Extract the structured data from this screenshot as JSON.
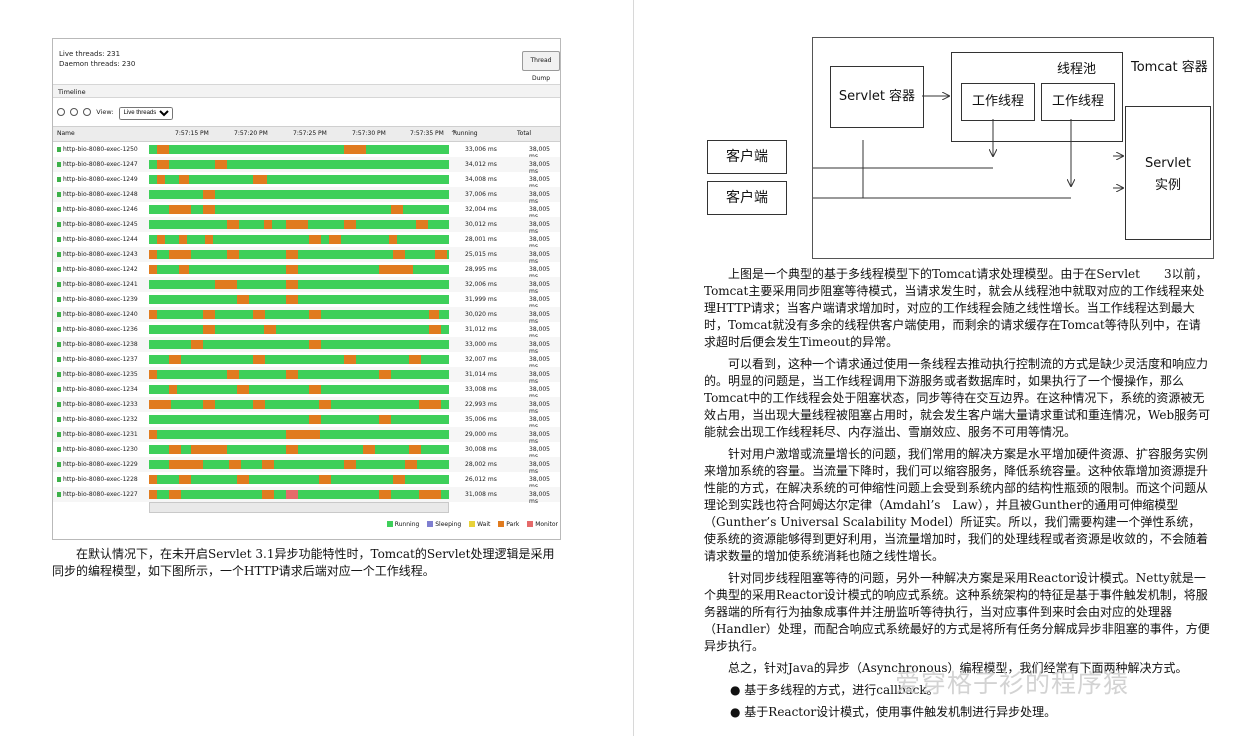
{
  "left_figure": {
    "live_threads": "Live threads: 231",
    "daemon_threads": "Daemon threads: 230",
    "thread_dump_button": "Thread Dump",
    "timeline_label": "Timeline",
    "view_label": "View:",
    "view_select": "Live threads",
    "columns": {
      "name": "Name",
      "running": "Running",
      "total": "Total"
    },
    "time_ticks": [
      "7:57:15 PM",
      "7:57:20 PM",
      "7:57:25 PM",
      "7:57:30 PM",
      "7:57:35 PM"
    ],
    "legend": [
      "Running",
      "Sleeping",
      "Wait",
      "Park",
      "Monitor"
    ],
    "colors": {
      "running": "#3ecf5a",
      "park": "#e07b1f",
      "monitor": "#e56a6a",
      "sleeping": "#7f7fd0",
      "wait": "#e8d23a"
    },
    "threads": [
      {
        "name": "http-bio-8080-exec-1250",
        "running": "33,006 ms",
        "total": "38,005 ms"
      },
      {
        "name": "http-bio-8080-exec-1247",
        "running": "34,012 ms",
        "total": "38,005 ms"
      },
      {
        "name": "http-bio-8080-exec-1249",
        "running": "34,008 ms",
        "total": "38,005 ms"
      },
      {
        "name": "http-bio-8080-exec-1248",
        "running": "37,006 ms",
        "total": "38,005 ms"
      },
      {
        "name": "http-bio-8080-exec-1246",
        "running": "32,004 ms",
        "total": "38,005 ms"
      },
      {
        "name": "http-bio-8080-exec-1245",
        "running": "30,012 ms",
        "total": "38,005 ms"
      },
      {
        "name": "http-bio-8080-exec-1244",
        "running": "28,001 ms",
        "total": "38,005 ms"
      },
      {
        "name": "http-bio-8080-exec-1243",
        "running": "25,015 ms",
        "total": "38,005 ms"
      },
      {
        "name": "http-bio-8080-exec-1242",
        "running": "28,995 ms",
        "total": "38,005 ms"
      },
      {
        "name": "http-bio-8080-exec-1241",
        "running": "32,006 ms",
        "total": "38,005 ms"
      },
      {
        "name": "http-bio-8080-exec-1239",
        "running": "31,999 ms",
        "total": "38,005 ms"
      },
      {
        "name": "http-bio-8080-exec-1240",
        "running": "30,020 ms",
        "total": "38,005 ms"
      },
      {
        "name": "http-bio-8080-exec-1236",
        "running": "31,012 ms",
        "total": "38,005 ms"
      },
      {
        "name": "http-bio-8080-exec-1238",
        "running": "33,000 ms",
        "total": "38,005 ms"
      },
      {
        "name": "http-bio-8080-exec-1237",
        "running": "32,007 ms",
        "total": "38,005 ms"
      },
      {
        "name": "http-bio-8080-exec-1235",
        "running": "31,014 ms",
        "total": "38,005 ms"
      },
      {
        "name": "http-bio-8080-exec-1234",
        "running": "33,008 ms",
        "total": "38,005 ms"
      },
      {
        "name": "http-bio-8080-exec-1233",
        "running": "22,993 ms",
        "total": "38,005 ms"
      },
      {
        "name": "http-bio-8080-exec-1232",
        "running": "35,006 ms",
        "total": "38,005 ms"
      },
      {
        "name": "http-bio-8080-exec-1231",
        "running": "29,000 ms",
        "total": "38,005 ms"
      },
      {
        "name": "http-bio-8080-exec-1230",
        "running": "30,008 ms",
        "total": "38,005 ms"
      },
      {
        "name": "http-bio-8080-exec-1229",
        "running": "28,002 ms",
        "total": "38,005 ms"
      },
      {
        "name": "http-bio-8080-exec-1228",
        "running": "26,012 ms",
        "total": "38,005 ms"
      },
      {
        "name": "http-bio-8080-exec-1227",
        "running": "31,008 ms",
        "total": "38,005 ms"
      }
    ],
    "caption": "在默认情况下，在未开启Servlet 3.1异步功能特性时，Tomcat的Servlet处理逻辑是采用同步的编程模型，如下图所示，一个HTTP请求后端对应一个工作线程。"
  },
  "diagram": {
    "container": "Tomcat 容器",
    "pool": "线程池",
    "servlet_container": "Servlet 容器",
    "worker1": "工作线程",
    "worker2": "工作线程",
    "client1": "客户端",
    "client2": "客户端",
    "servlet_instance_line1": "Servlet",
    "servlet_instance_line2": "实例"
  },
  "right_text": {
    "p1": "上图是一个典型的基于多线程模型下的Tomcat请求处理模型。由于在Servlet　　3以前，Tomcat主要采用同步阻塞等待模式，当请求发生时，就会从线程池中就取对应的工作线程来处理HTTP请求；当客户端请求增加时，对应的工作线程会随之线性增长。当工作线程达到最大时，Tomcat就没有多余的线程供客户端使用，而剩余的请求缓存在Tomcat等待队列中，在请求超时后便会发生Timeout的异常。",
    "p2": "可以看到，这种一个请求通过使用一条线程去推动执行控制流的方式是缺少灵活度和响应力的。明显的问题是，当工作线程调用下游服务或者数据库时，如果执行了一个慢操作，那么Tomcat中的工作线程会处于阻塞状态，同步等待在交互边界。在这种情况下，系统的资源被无效占用，当出现大量线程被阻塞占用时，就会发生客户端大量请求重试和重连情况，Web服务可能就会出现工作线程耗尽、内存溢出、雪崩效应、服务不可用等情况。",
    "p3": "针对用户激增或流量增长的问题，我们常用的解决方案是水平增加硬件资源、扩容服务实例来增加系统的容量。当流量下降时，我们可以缩容服务，降低系统容量。这种依靠增加资源提升性能的方式，在解决系统的可伸缩性问题上会受到系统内部的结构性瓶颈的限制。而这个问题从理论到实践也符合阿姆达尔定律（Amdahl’s　Law），并且被Gunther的通用可伸缩模型（Gunther’s Universal Scalability Model）所证实。所以，我们需要构建一个弹性系统，使系统的资源能够得到更好利用，当流量增加时，我们的处理线程或者资源是收敛的，不会随着请求数量的增加使系统消耗也随之线性增长。",
    "p4": "针对同步线程阻塞等待的问题，另外一种解决方案是采用Reactor设计模式。Netty就是一个典型的采用Reactor设计模式的响应式系统。这种系统架构的特征是基于事件触发机制，将服务器端的所有行为抽象成事件并注册监听等待执行，当对应事件到来时会由对应的处理器（Handler）处理，而配合响应式系统最好的方式是将所有任务分解成异步非阻塞的事件，方便异步执行。",
    "p5": "总之，针对Java的异步（Asynchronous）编程模型，我们经常有下面两种解决方式。",
    "b1": "● 基于多线程的方式，进行callback。",
    "b2": "● 基于Reactor设计模式，使用事件触发机制进行异步处理。"
  },
  "watermark": "爱穿格子衫的程序猿"
}
